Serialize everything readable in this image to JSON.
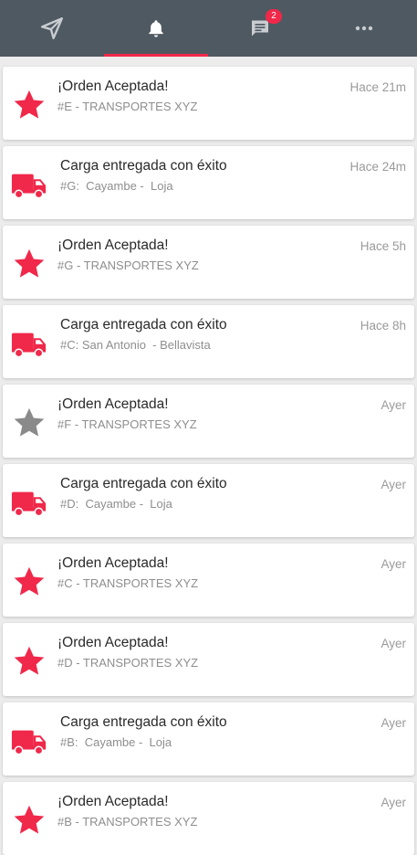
{
  "tabs": [
    {
      "name": "tab-explore",
      "icon": "navigation-arrow-icon",
      "active": false
    },
    {
      "name": "tab-notifications",
      "icon": "bell-icon",
      "active": true
    },
    {
      "name": "tab-messages",
      "icon": "chat-icon",
      "active": false,
      "badge": "2"
    },
    {
      "name": "tab-more",
      "icon": "more-dots-icon",
      "active": false
    }
  ],
  "colors": {
    "accent": "#f0284a",
    "topbar": "#4f5961",
    "inactive_star": "#8a8a8a"
  },
  "notifications": [
    {
      "kind": "order",
      "title": "¡Orden Aceptada!",
      "subtitle": "#E - TRANSPORTES XYZ",
      "time": "Hace 21m",
      "icon": "star-icon",
      "icon_color": "#f0284a"
    },
    {
      "kind": "delivery",
      "title": "Carga entregada con éxito",
      "subtitle": "#G:  Cayambe -  Loja",
      "time": "Hace 24m",
      "icon": "truck-icon",
      "icon_color": "#f0284a"
    },
    {
      "kind": "order",
      "title": "¡Orden Aceptada!",
      "subtitle": "#G - TRANSPORTES XYZ",
      "time": "Hace 5h",
      "icon": "star-icon",
      "icon_color": "#f0284a"
    },
    {
      "kind": "delivery",
      "title": "Carga entregada con éxito",
      "subtitle": "#C: San Antonio  - Bellavista",
      "time": "Hace 8h",
      "icon": "truck-icon",
      "icon_color": "#f0284a"
    },
    {
      "kind": "order",
      "title": "¡Orden Aceptada!",
      "subtitle": "#F - TRANSPORTES XYZ",
      "time": "Ayer",
      "icon": "star-icon",
      "icon_color": "#8a8a8a"
    },
    {
      "kind": "delivery",
      "title": "Carga entregada con éxito",
      "subtitle": "#D:  Cayambe -  Loja",
      "time": "Ayer",
      "icon": "truck-icon",
      "icon_color": "#f0284a"
    },
    {
      "kind": "order",
      "title": "¡Orden Aceptada!",
      "subtitle": "#C - TRANSPORTES XYZ",
      "time": "Ayer",
      "icon": "star-icon",
      "icon_color": "#f0284a"
    },
    {
      "kind": "order",
      "title": "¡Orden Aceptada!",
      "subtitle": "#D - TRANSPORTES XYZ",
      "time": "Ayer",
      "icon": "star-icon",
      "icon_color": "#f0284a"
    },
    {
      "kind": "delivery",
      "title": "Carga entregada con éxito",
      "subtitle": "#B:  Cayambe -  Loja",
      "time": "Ayer",
      "icon": "truck-icon",
      "icon_color": "#f0284a"
    },
    {
      "kind": "order",
      "title": "¡Orden Aceptada!",
      "subtitle": "#B - TRANSPORTES XYZ",
      "time": "Ayer",
      "icon": "star-icon",
      "icon_color": "#f0284a"
    }
  ]
}
